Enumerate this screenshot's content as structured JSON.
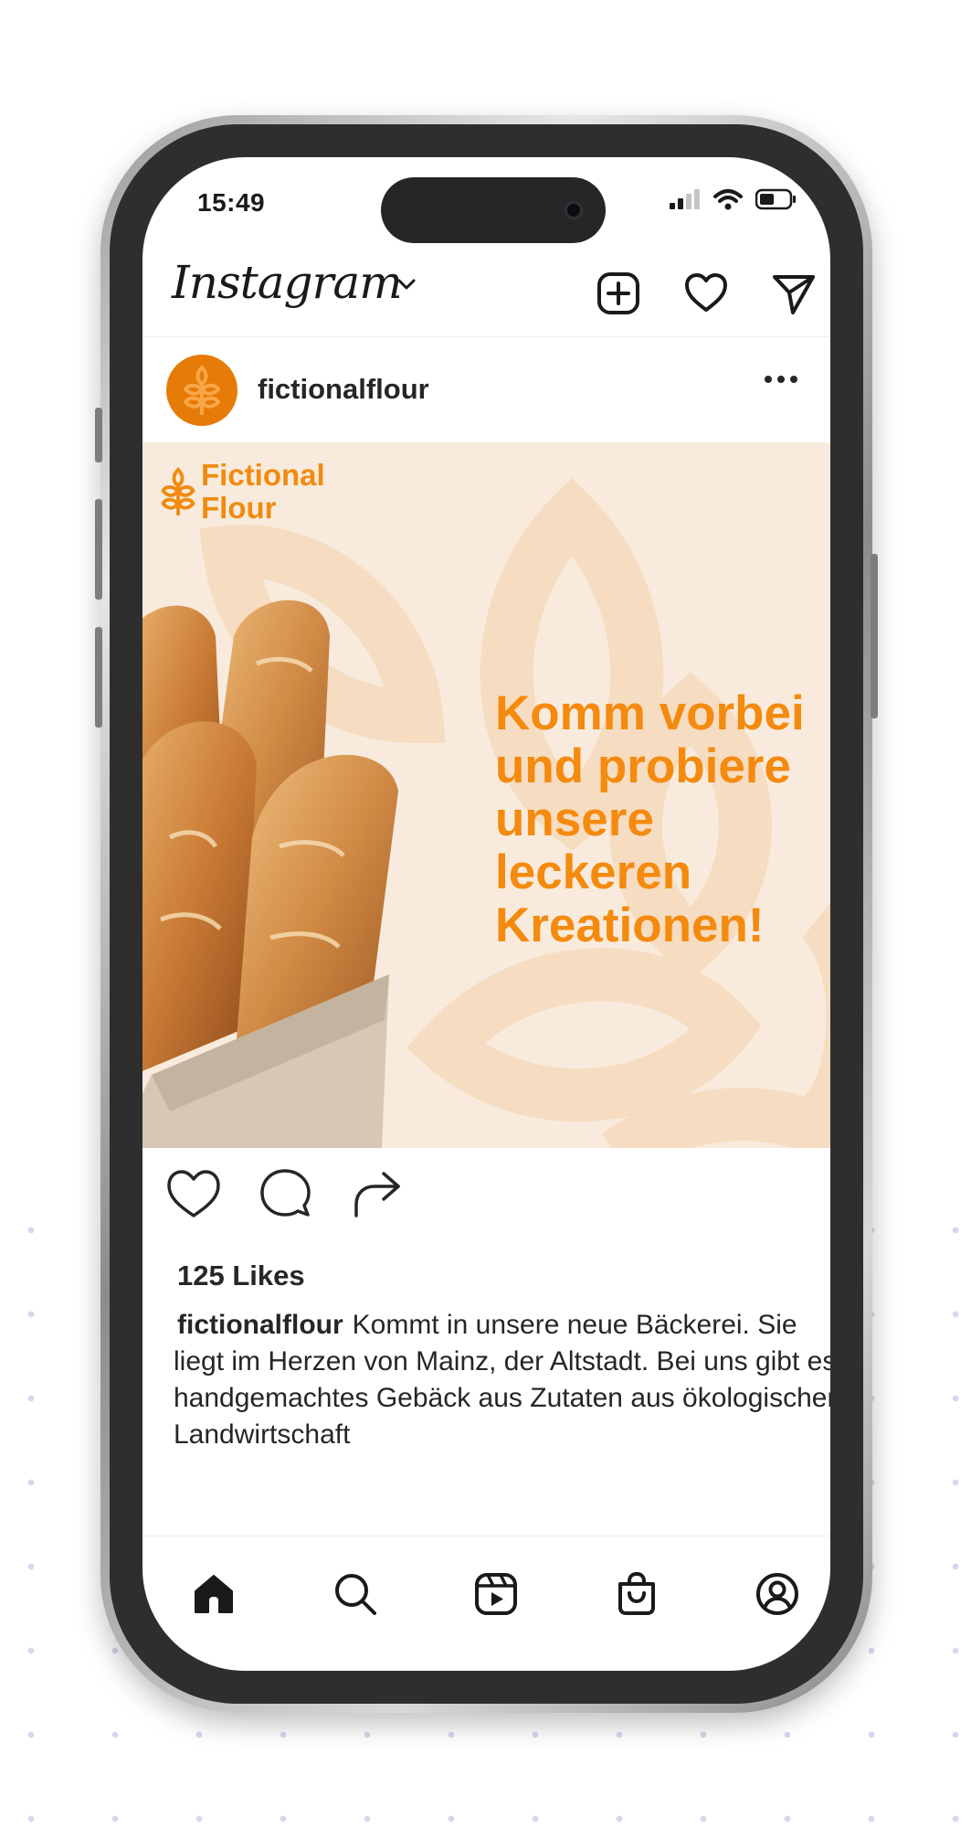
{
  "status_bar": {
    "time": "15:49"
  },
  "app": {
    "name": "Instagram"
  },
  "post": {
    "username": "fictionalflour",
    "brand_line1": "Fictional",
    "brand_line2": "Flour",
    "headline": "Komm vorbei und probiere unsere leckeren Kreationen!",
    "likes": "125 Likes",
    "caption_user": "fictionalflour",
    "caption_text": "Kommt in unsere neue Bäckerei. Sie liegt im Herzen von Mainz, der Altstadt. Bei uns gibt es handgemachtes Gebäck aus Zutaten aus ökologischer Landwirtschaft"
  },
  "icons": {
    "header": [
      "chevron-down-icon",
      "add-post-icon",
      "heart-icon",
      "send-icon"
    ],
    "post": [
      "more-options-icon",
      "like-icon",
      "comment-icon",
      "share-icon"
    ],
    "tabbar": [
      "home-icon",
      "search-icon",
      "reels-icon",
      "shop-icon",
      "profile-icon"
    ]
  },
  "colors": {
    "brand_orange": "#f48a0e",
    "image_background": "#f8ebdd",
    "avatar": "#e67b08"
  }
}
